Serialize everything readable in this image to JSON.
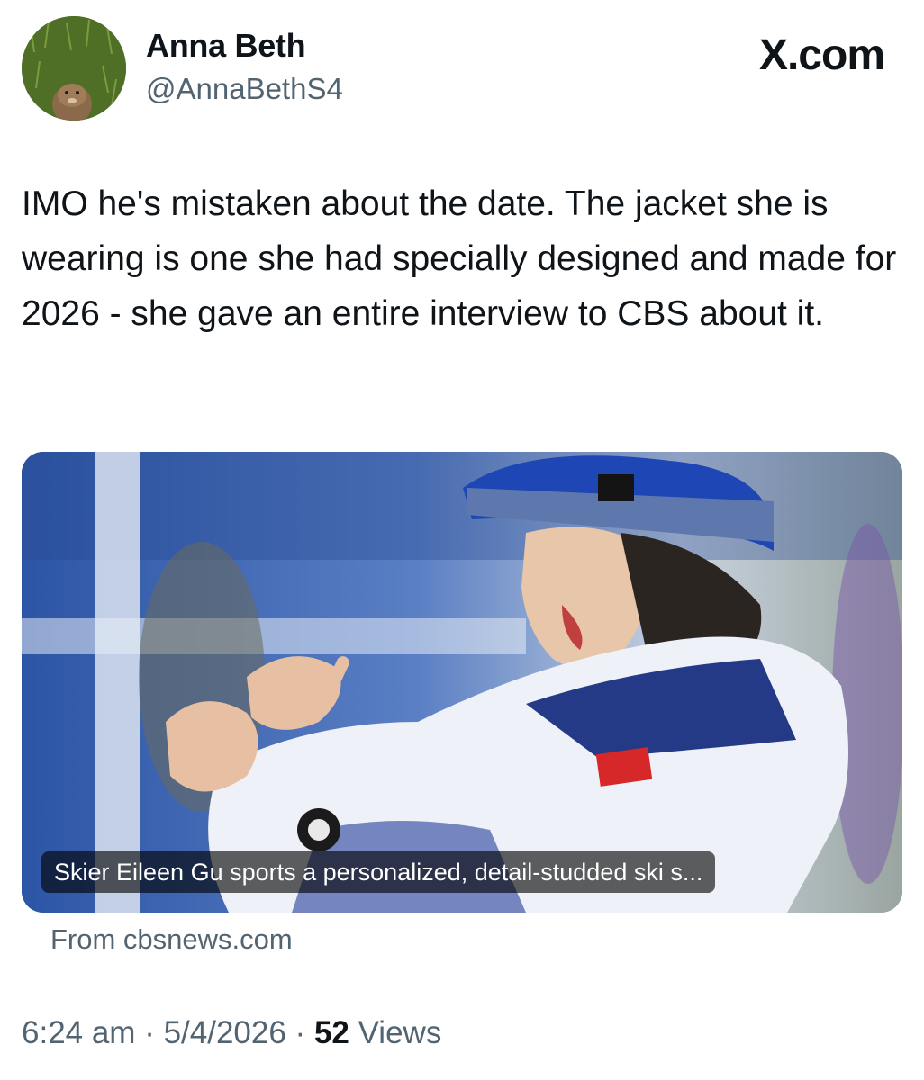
{
  "author": {
    "display_name": "Anna Beth",
    "handle": "@AnnaBethS4"
  },
  "brand": "X.com",
  "tweet": {
    "text": "IMO he's mistaken about the date. The jacket she is wearing is one she had specially designed and made for 2026 - she gave an entire interview to CBS about it."
  },
  "link_card": {
    "caption": "Skier Eileen Gu sports a personalized, detail-studded ski s...",
    "source": "From cbsnews.com"
  },
  "meta": {
    "time": "6:24 am",
    "sep1": " · ",
    "date": "5/4/2026",
    "sep2": " · ",
    "view_count": "52",
    "views_label": " Views"
  },
  "colors": {
    "text_primary": "#0f1419",
    "text_secondary": "#536471"
  },
  "icons": {
    "avatar": "prairie-dog-avatar-icon"
  }
}
